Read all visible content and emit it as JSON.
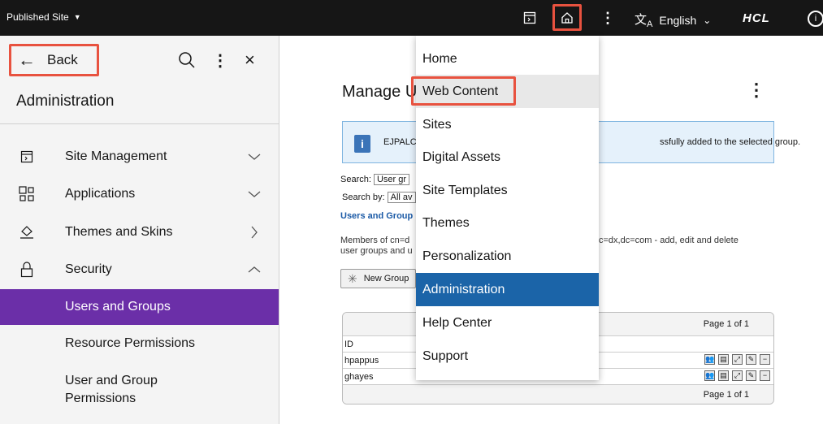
{
  "topbar": {
    "site_label": "Published Site",
    "language": "English",
    "brand": "HCL",
    "info_glyph": "i"
  },
  "left_panel": {
    "back_label": "Back",
    "title": "Administration",
    "nav_items": [
      {
        "label": "Site Management",
        "icon": "site-management-icon",
        "chevron": "down"
      },
      {
        "label": "Applications",
        "icon": "applications-icon",
        "chevron": "down"
      },
      {
        "label": "Themes and Skins",
        "icon": "themes-icon",
        "chevron": "right"
      },
      {
        "label": "Security",
        "icon": "lock-icon",
        "chevron": "up"
      }
    ],
    "sub_items": [
      {
        "label": "Users and Groups",
        "active": true
      },
      {
        "label": "Resource Permissions",
        "active": false
      },
      {
        "label": "User and Group\nPermissions",
        "active": false
      }
    ]
  },
  "main": {
    "title": "Manage U",
    "info_message_left": "EJPALC",
    "info_message_right": "ssfully added to the selected group.",
    "search_label": "Search:",
    "search_value": "User gr",
    "search_by_label": "Search by:",
    "search_by_value": "All av",
    "breadcrumb_link": "Users and Group",
    "members_text_left": "Members of cn=d",
    "members_text_right": "c=dx,dc=com - add, edit and delete",
    "members_text_line2": "user groups and u",
    "new_group_label": "New Group",
    "table": {
      "page_header": "Page 1 of 1",
      "column_id": "ID",
      "rows": [
        "hpappus",
        "ghayes"
      ],
      "page_footer": "Page 1 of 1"
    }
  },
  "menu": {
    "items": [
      {
        "label": "Home",
        "state": "normal"
      },
      {
        "label": "Web Content",
        "state": "hover"
      },
      {
        "label": "Sites",
        "state": "normal"
      },
      {
        "label": "Digital Assets",
        "state": "normal"
      },
      {
        "label": "Site Templates",
        "state": "normal"
      },
      {
        "label": "Themes",
        "state": "normal"
      },
      {
        "label": "Personalization",
        "state": "normal"
      },
      {
        "label": "Administration",
        "state": "selected"
      },
      {
        "label": "Help Center",
        "state": "normal"
      },
      {
        "label": "Support",
        "state": "normal"
      }
    ]
  },
  "colors": {
    "topbar_bg": "#161616",
    "highlight_border": "#e8523f",
    "active_nav_bg": "#6b2fa8",
    "menu_selected_bg": "#1b64a8",
    "info_bg": "#e5f1fb"
  }
}
